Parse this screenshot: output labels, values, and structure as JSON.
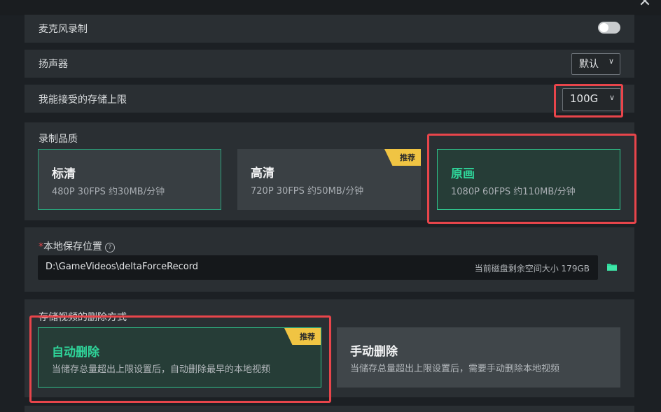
{
  "window": {
    "close_glyph": "✕"
  },
  "mic": {
    "label": "麦克风录制",
    "enabled": false
  },
  "speaker": {
    "label": "扬声器",
    "value": "默认"
  },
  "storage_limit": {
    "label": "我能接受的存储上限",
    "value": "100G"
  },
  "quality": {
    "label": "录制品质",
    "options": [
      {
        "title": "标清",
        "desc": "480P 30FPS 约30MB/分钟",
        "recommended": false,
        "selected": false
      },
      {
        "title": "高清",
        "desc": "720P 30FPS 约50MB/分钟",
        "recommended": true,
        "selected": false
      },
      {
        "title": "原画",
        "desc": "1080P 60FPS 约110MB/分钟",
        "recommended": false,
        "selected": true
      }
    ],
    "recommend_badge": "推荐"
  },
  "save_location": {
    "required_mark": "*",
    "label": "本地保存位置",
    "help_glyph": "?",
    "path": "D:\\GameVideos\\deltaForceRecord",
    "free_space": "当前磁盘剩余空间大小 179GB",
    "folder_icon": "folder-icon"
  },
  "delete_mode": {
    "label": "存储视频的删除方式",
    "options": [
      {
        "title": "自动删除",
        "desc": "当储存总量超出上限设置后，自动删除最早的本地视频",
        "recommended": true,
        "selected": true
      },
      {
        "title": "手动删除",
        "desc": "当储存总量超出上限设置后，需要手动删除本地视频",
        "recommended": false,
        "selected": false
      }
    ],
    "recommend_badge": "推荐"
  },
  "colors": {
    "accent": "#2fd59a",
    "highlight": "#e8454b",
    "badge": "#f0c443",
    "panel": "#2a2f33"
  }
}
